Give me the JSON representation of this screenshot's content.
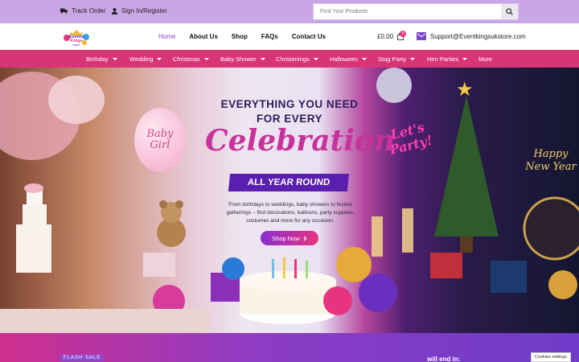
{
  "topbar": {
    "track_order": "Track Order",
    "sign_in": "Sign In/Register",
    "search_placeholder": "Find Your Products"
  },
  "header": {
    "logo_lines": [
      "Events",
      "Kings",
      "Store"
    ],
    "nav": [
      "Home",
      "About Us",
      "Shop",
      "FAQs",
      "Contact Us"
    ],
    "cart_total": "£0.00",
    "cart_count": "0",
    "support_email": "Support@Eventkingsukstore.com"
  },
  "categories": [
    "Birthday",
    "Wedding",
    "Christmas",
    "Baby Shower",
    "Christenings",
    "Halloween",
    "Stag Party",
    "Hen Parties",
    "More"
  ],
  "hero": {
    "line1": "EVERYTHING YOU NEED",
    "line2": "FOR EVERY",
    "headline": "Celebration",
    "ribbon": "ALL YEAR ROUND",
    "description": "From birthdays to weddings, baby showers to festive gatherings – find decorations, balloons, party supplies, costumes and more for any occasion.",
    "button": "Shop Now",
    "balloon_text": [
      "Baby",
      "Girl"
    ],
    "neon_text": [
      "Let's",
      "Party!"
    ],
    "new_year_text": [
      "Happy",
      "New Year"
    ]
  },
  "flash": {
    "badge": "FLASH SALE",
    "countdown_label": "will end in:"
  },
  "cookie": "Cookies settings",
  "colors": {
    "topbar": "#c9a6e6",
    "category_bar": "#d83577",
    "accent": "#8a3fc6",
    "pink": "#e8337f"
  }
}
